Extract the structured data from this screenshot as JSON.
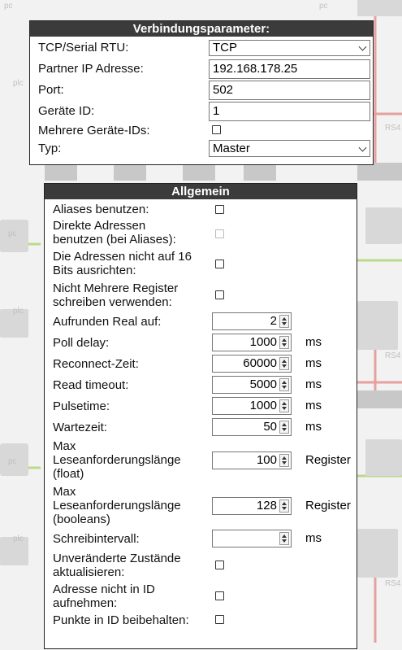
{
  "connection": {
    "title": "Verbindungsparameter:",
    "rows": [
      {
        "label": "TCP/Serial RTU:",
        "value": "TCP"
      },
      {
        "label": "Partner IP Adresse:",
        "value": "192.168.178.25"
      },
      {
        "label": "Port:",
        "value": "502"
      },
      {
        "label": "Geräte ID:",
        "value": "1"
      },
      {
        "label": "Mehrere Geräte-IDs:",
        "checked": false
      },
      {
        "label": "Typ:",
        "value": "Master"
      }
    ]
  },
  "general": {
    "title": "Allgemein",
    "checkbox_rows": {
      "aliases": "Aliases benutzen:",
      "direct_l1": "Direkte Adressen",
      "direct_l2": "benutzen (bei Aliases):",
      "align_l1": "Die Adressen nicht auf 16",
      "align_l2": "Bits ausrichten:",
      "multi_l1": "Nicht Mehrere Register",
      "multi_l2": "schreiben verwenden:",
      "unchanged_l1": "Unveränderte Zustände",
      "unchanged_l2": "aktualisieren:",
      "noaddr_l1": "Adresse nicht in ID",
      "noaddr_l2": "aufnehmen:",
      "keepdots": "Punkte in ID beibehalten:"
    },
    "numeric": {
      "round_label": "Aufrunden Real auf:",
      "round_value": "2",
      "poll_label": "Poll delay:",
      "poll_value": "1000",
      "poll_unit": "ms",
      "reconnect_label": "Reconnect-Zeit:",
      "reconnect_value": "60000",
      "reconnect_unit": "ms",
      "read_label": "Read timeout:",
      "read_value": "5000",
      "read_unit": "ms",
      "pulse_label": "Pulsetime:",
      "pulse_value": "1000",
      "pulse_unit": "ms",
      "wait_label": "Wartezeit:",
      "wait_value": "50",
      "wait_unit": "ms",
      "maxf_l1": "Max",
      "maxf_l2": "Leseanforderungslänge",
      "maxf_l3": "(float)",
      "maxf_value": "100",
      "maxf_unit": "Register",
      "maxb_l1": "Max",
      "maxb_l2": "Leseanforderungslänge",
      "maxb_l3": "(booleans)",
      "maxb_value": "128",
      "maxb_unit": "Register",
      "write_label": "Schreibintervall:",
      "write_value": "",
      "write_unit": "ms"
    }
  },
  "colors": {
    "header_bg": "#3b3b3b",
    "bg": "#f2f2f2",
    "accent_red": "#e06060",
    "accent_green": "#8bc34a"
  }
}
